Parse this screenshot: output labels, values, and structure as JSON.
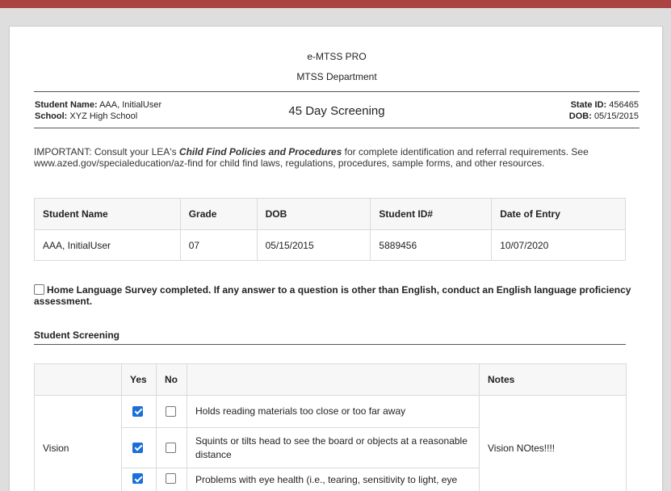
{
  "header": {
    "org": "e-MTSS PRO",
    "department": "MTSS Department",
    "doc_title": "45 Day Screening"
  },
  "student_info": {
    "name_label": "Student Name:",
    "name_value": "AAA, InitialUser",
    "school_label": "School:",
    "school_value": "XYZ High School",
    "state_id_label": "State ID:",
    "state_id_value": "456465",
    "dob_label": "DOB:",
    "dob_value": "05/15/2015"
  },
  "important": {
    "prefix": "IMPORTANT: Consult your LEA's ",
    "emphasis": "Child Find Policies and Procedures",
    "suffix": " for complete identification and referral requirements. See www.azed.gov/specialeducation/az-find for child find laws, regulations, procedures, sample forms, and other resources."
  },
  "student_table": {
    "headers": [
      "Student Name",
      "Grade",
      "DOB",
      "Student ID#",
      "Date of Entry"
    ],
    "row": [
      "AAA, InitialUser",
      "07",
      "05/15/2015",
      "5889456",
      "10/07/2020"
    ]
  },
  "home_language": {
    "checked": false,
    "label": "Home Language Survey completed. If any answer to a question is other than English, conduct an English language proficiency assessment."
  },
  "screening": {
    "title": "Student Screening",
    "headers": {
      "yes": "Yes",
      "no": "No",
      "notes": "Notes"
    },
    "category": "Vision",
    "notes": "Vision NOtes!!!!",
    "questions": [
      {
        "text": "Holds reading materials too close or too far away",
        "yes": true,
        "no": false
      },
      {
        "text": "Squints or tilts head to see the board or objects at a reasonable distance",
        "yes": true,
        "no": false
      },
      {
        "text": "Problems with eye health (i.e., tearing, sensitivity to light, eye",
        "yes": true,
        "no": false
      }
    ]
  },
  "colors": {
    "topbar": "#a94442",
    "checkbox_checked": "#1a6fd8"
  }
}
